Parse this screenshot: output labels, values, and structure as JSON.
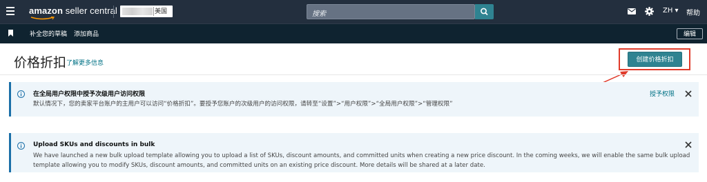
{
  "topbar": {
    "logo_brand": "amazon",
    "logo_product": " seller central",
    "account_region": "美国",
    "search_placeholder": "搜索",
    "language": "ZH ▾",
    "help": "帮助"
  },
  "subnav": {
    "links": [
      "补全您的草稿",
      "添加商品"
    ],
    "edit_label": "编辑"
  },
  "page": {
    "title": "价格折扣",
    "learn_more": "了解更多信息",
    "create_button": "创建价格折扣"
  },
  "alerts": [
    {
      "title": "在全局用户权限中授予次级用户访问权限",
      "text": "默认情况下，您的卖家平台账户的主用户可以访问“价格折扣”。要授予您账户的次级用户的访问权限，请转至“设置”>“用户权限”>“全局用户权限”>“管理权限”",
      "action": "授予权限"
    },
    {
      "title": "Upload SKUs and discounts in bulk",
      "text_line1": "We have launched a new bulk upload template allowing you to upload a list of SKUs, discount amounts, and committed units when creating a new price discount. In the coming weeks, we will enable the same bulk upload",
      "text_line2": "template allowing you to modify SKUs, discount amounts, and committed units on an existing price discount. More details will be shared at a later date."
    }
  ],
  "colors": {
    "topbar": "#232f3e",
    "subnav": "#0f2330",
    "accent": "#2f8391",
    "link": "#007185",
    "annotation": "#e03a2a",
    "alert_bg": "#eef5fa",
    "alert_border": "#1b6fa8"
  },
  "icons": [
    "menu-icon",
    "search-icon",
    "mail-icon",
    "gear-icon",
    "bookmark-icon",
    "info-icon",
    "close-icon"
  ]
}
